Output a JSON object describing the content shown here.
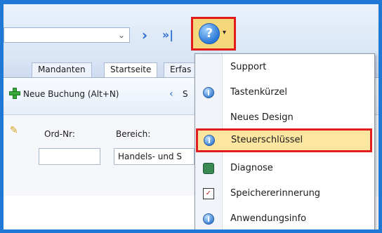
{
  "toolbar": {
    "combo_arrow": "⌄",
    "nav_next": "›",
    "nav_last": "»|",
    "help_icon": "?",
    "help_caret": "▾"
  },
  "tabs": [
    {
      "label": "Mandanten"
    },
    {
      "label": "Startseite"
    },
    {
      "label": "Erfas"
    }
  ],
  "ribbon": {
    "new_booking_label": "Neue Buchung (Alt+N)",
    "share_label": "S"
  },
  "form": {
    "ord_label": "Ord-Nr:",
    "bereich_label": "Bereich:",
    "bereich_value": "Handels- und S"
  },
  "menu": {
    "items": [
      {
        "label": "Support",
        "icon": "none"
      },
      {
        "label": "Tastenkürzel",
        "icon": "info-icon"
      },
      {
        "label": "Neues Design",
        "icon": "none"
      },
      {
        "label": "Steuerschlüssel",
        "icon": "info-icon",
        "highlighted": true
      },
      {
        "label": "Diagnose",
        "icon": "diagnose-icon"
      },
      {
        "label": "Speichererinnerung",
        "icon": "memory-reminder-icon"
      },
      {
        "label": "Anwendungsinfo",
        "icon": "info-icon"
      }
    ]
  },
  "colors": {
    "frame": "#1f77d6",
    "highlight_border": "#e01c1c",
    "highlight_fill": "#fde6a0"
  }
}
